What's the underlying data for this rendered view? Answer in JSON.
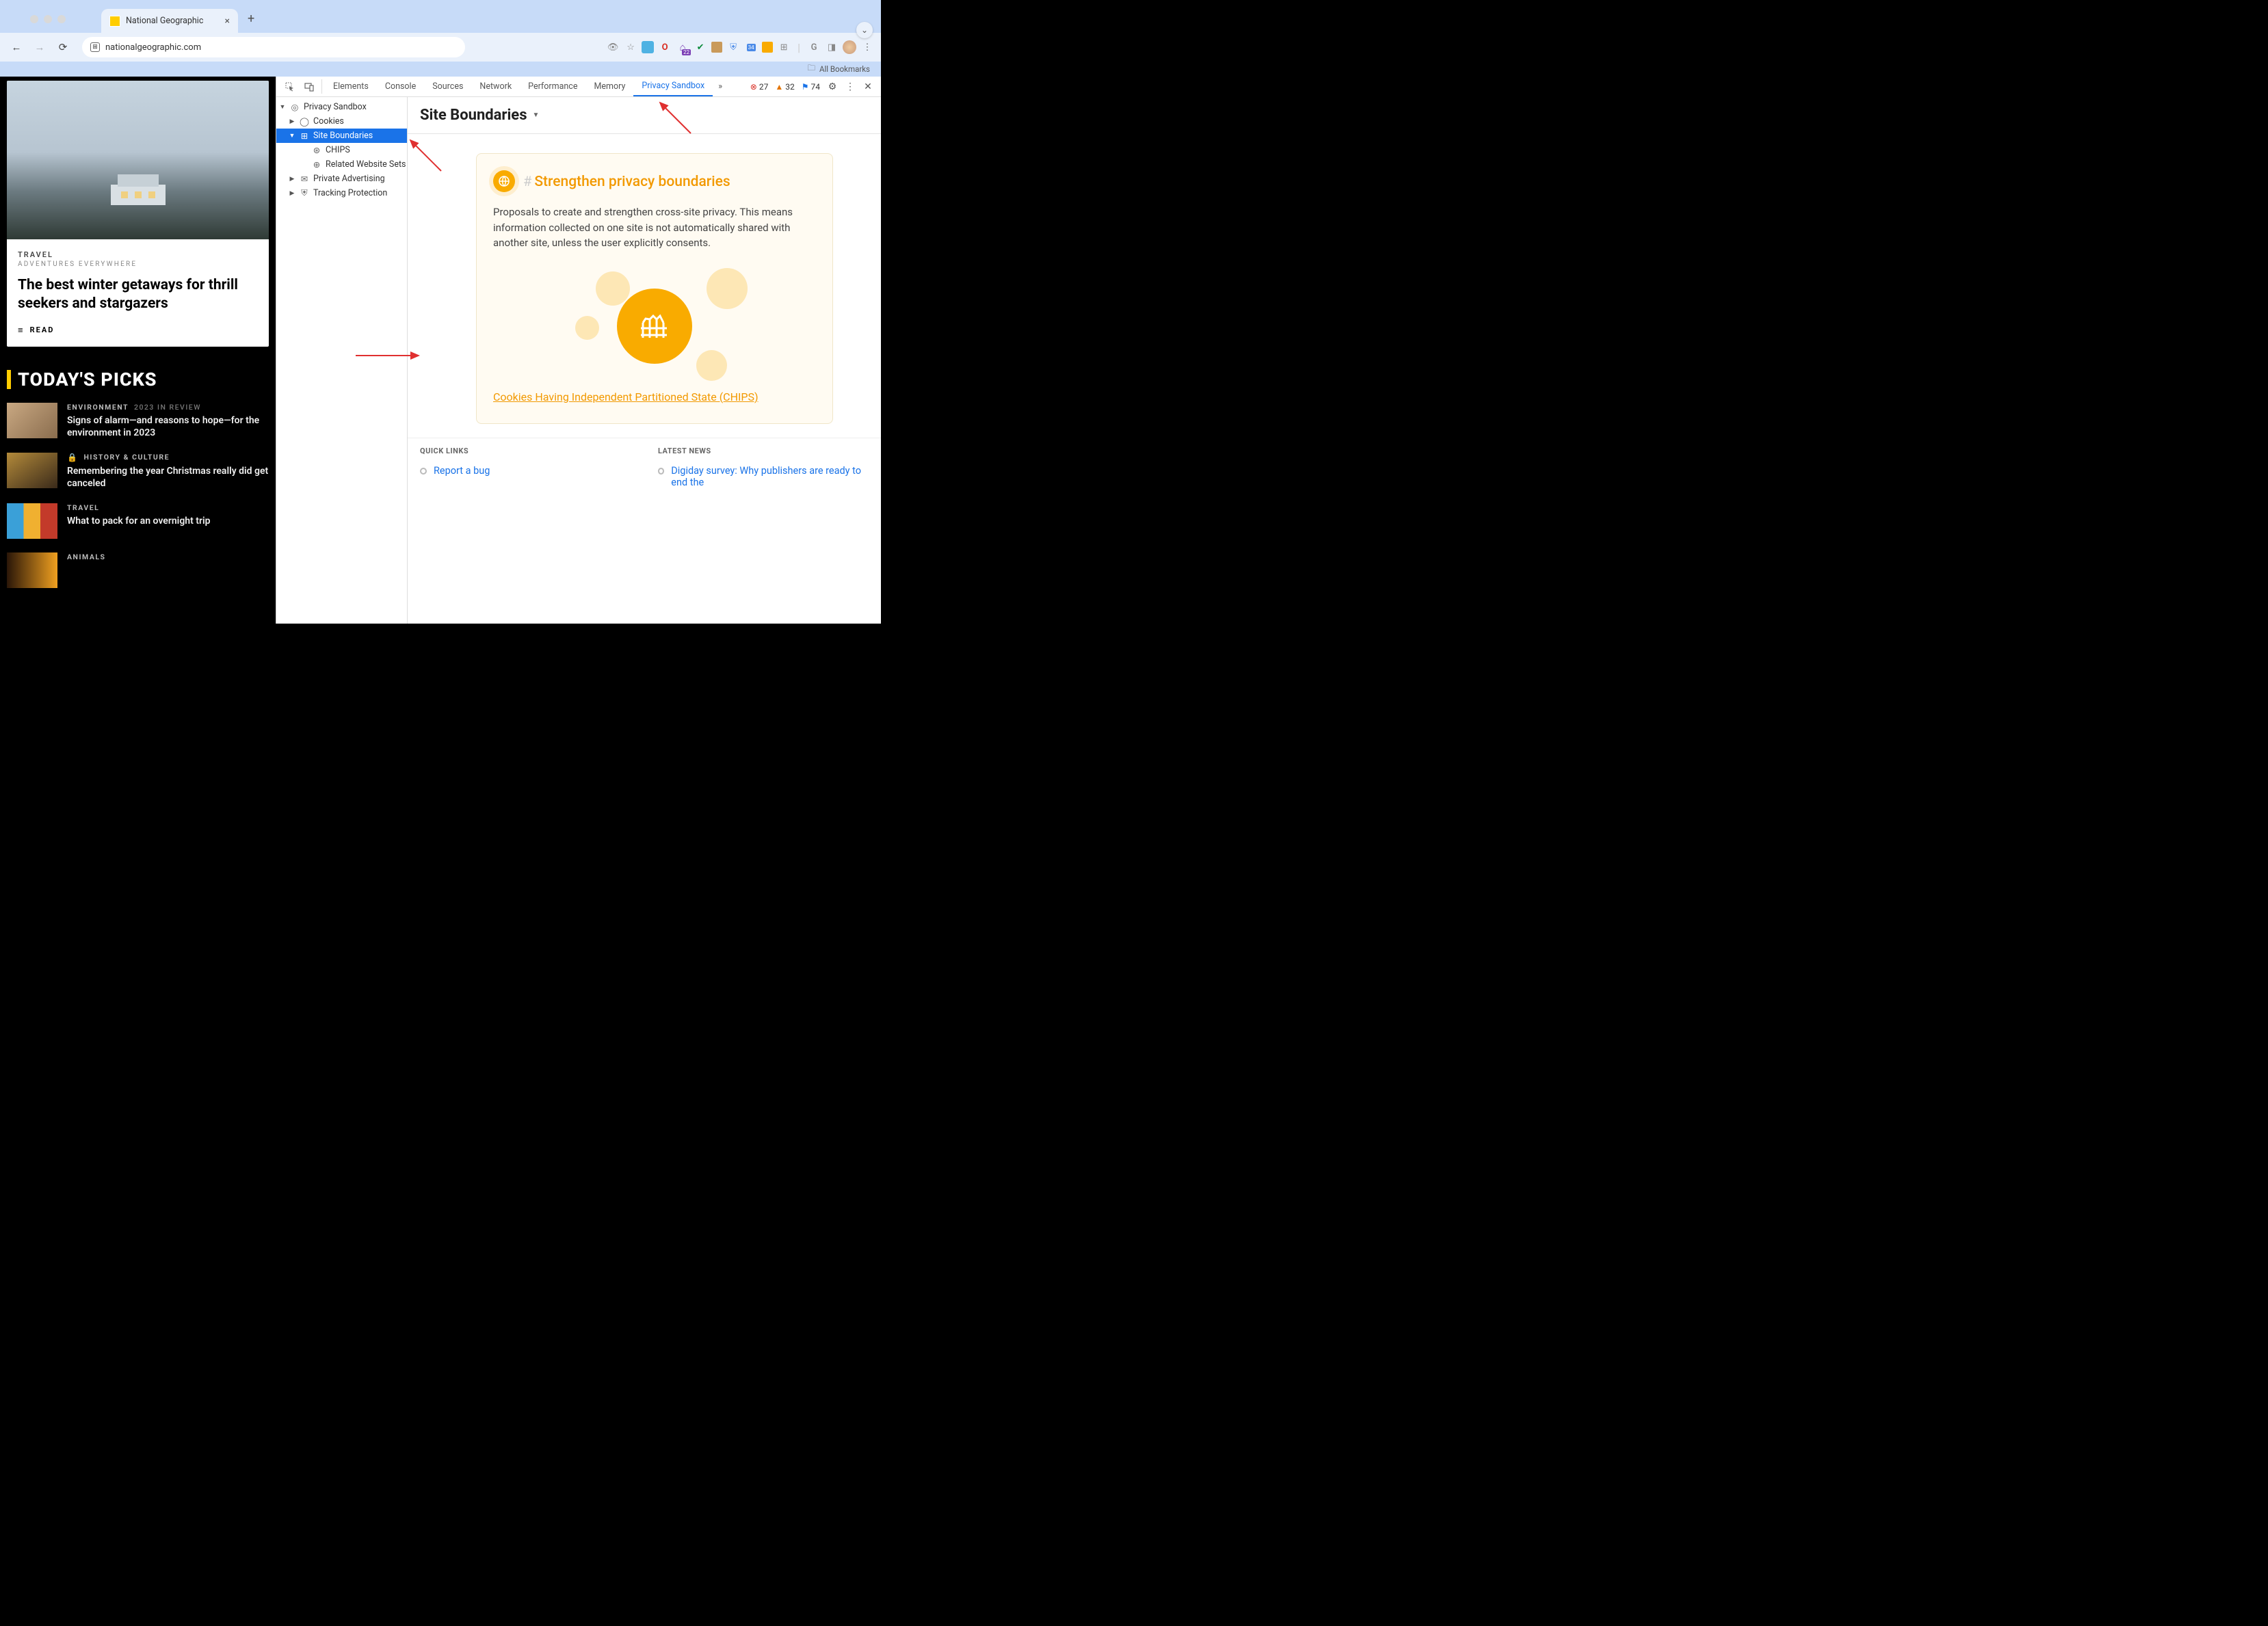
{
  "browser": {
    "tab_title": "National Geographic",
    "url": "nationalgeographic.com",
    "bookmarks_label": "All Bookmarks",
    "ext_badges": {
      "purple": "22",
      "cal": "34"
    }
  },
  "page": {
    "hero": {
      "eyebrow": "TRAVEL",
      "subeyebrow": "ADVENTURES EVERYWHERE",
      "title": "The best winter getaways for thrill seekers and stargazers",
      "action": "READ"
    },
    "picks_title": "TODAY'S PICKS",
    "picks": [
      {
        "cat": "ENVIRONMENT",
        "year": "2023 IN REVIEW",
        "title": "Signs of alarm—and reasons to hope—for the environment in 2023",
        "thumb_css": "linear-gradient(135deg,#c9a882,#8a6d4e)"
      },
      {
        "cat": "HISTORY & CULTURE",
        "lock": true,
        "title": "Remembering the year Christmas really did get canceled",
        "thumb_css": "linear-gradient(145deg,#b38a3a,#3a2a1a)"
      },
      {
        "cat": "TRAVEL",
        "title": "What to pack for an overnight trip",
        "thumb_css": "linear-gradient(90deg,#3aa0d8 0 33%,#f0b030 33% 66%,#c33a2a 66%);"
      },
      {
        "cat": "ANIMALS",
        "title": "",
        "thumb_css": "linear-gradient(90deg,#2a1608,#f0a020)"
      }
    ]
  },
  "devtools": {
    "tabs": [
      "Elements",
      "Console",
      "Sources",
      "Network",
      "Performance",
      "Memory",
      "Privacy Sandbox"
    ],
    "active_tab": "Privacy Sandbox",
    "counts": {
      "errors": "27",
      "warnings": "32",
      "issues": "74"
    },
    "tree": {
      "root": "Privacy Sandbox",
      "items": [
        {
          "label": "Cookies",
          "icon": "cookie",
          "expand": true
        },
        {
          "label": "Site Boundaries",
          "icon": "bounds",
          "expand": true,
          "selected": true,
          "children": [
            {
              "label": "CHIPS",
              "icon": "chips"
            },
            {
              "label": "Related Website Sets",
              "icon": "sets"
            }
          ]
        },
        {
          "label": "Private Advertising",
          "icon": "ad",
          "expand": true
        },
        {
          "label": "Tracking Protection",
          "icon": "shield",
          "expand": true
        }
      ]
    },
    "detail": {
      "heading": "Site Boundaries",
      "card_title": "Strengthen privacy boundaries",
      "card_body": "Proposals to create and strengthen cross-site privacy. This means information collected on one site is not automatically shared with another site, unless the user explicitly consents.",
      "card_link": "Cookies Having Independent Partitioned State (CHIPS)",
      "quick_links_head": "QUICK LINKS",
      "quick_links": [
        "Report a bug"
      ],
      "latest_news_head": "LATEST NEWS",
      "latest_news": [
        "Digiday survey: Why publishers are ready to end the"
      ]
    }
  }
}
